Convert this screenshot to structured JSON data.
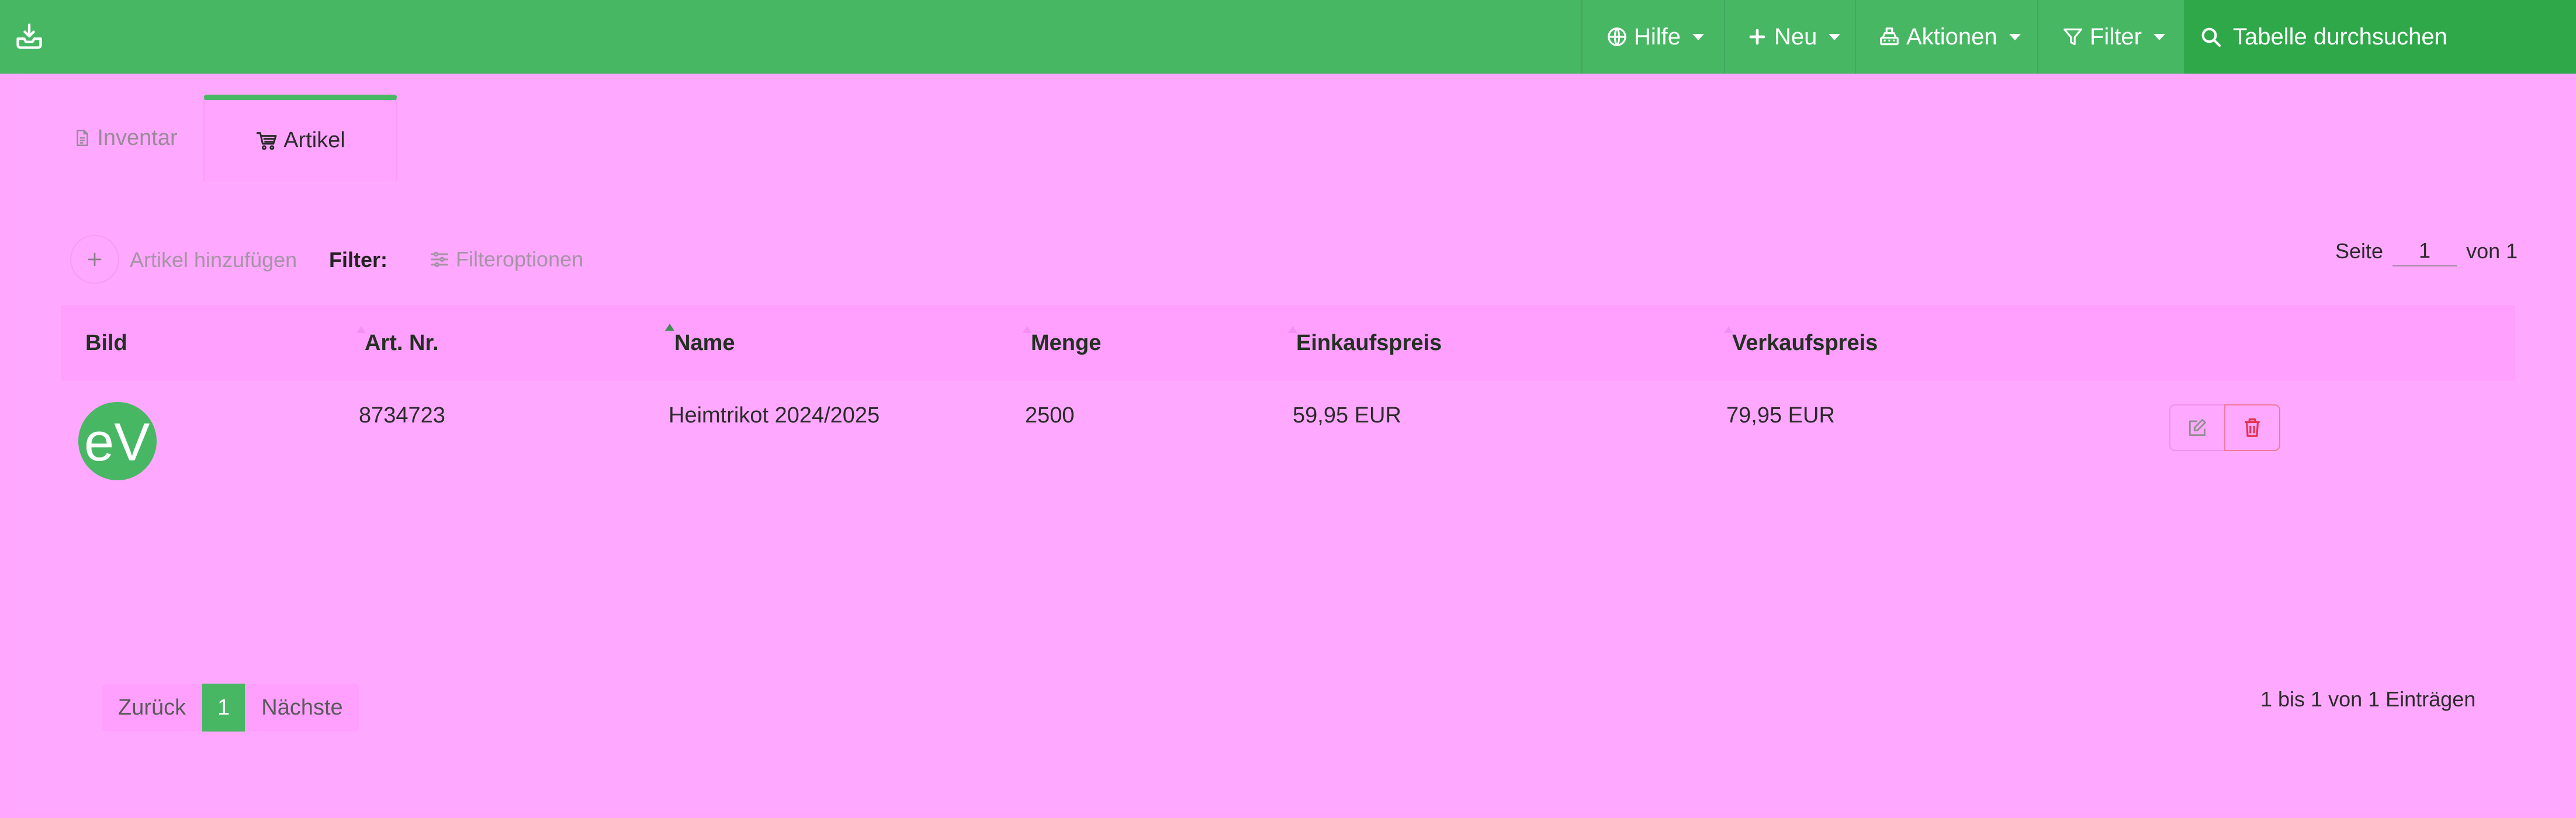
{
  "topbar": {
    "nav": [
      {
        "label": "Hilfe",
        "icon": "globe-icon"
      },
      {
        "label": "Neu",
        "icon": "plus-icon"
      },
      {
        "label": "Aktionen",
        "icon": "cash-register-icon"
      },
      {
        "label": "Filter",
        "icon": "funnel-icon"
      }
    ],
    "search_placeholder": "Tabelle durchsuchen"
  },
  "tabs": [
    {
      "label": "Inventar",
      "icon": "document-icon",
      "active": false
    },
    {
      "label": "Artikel",
      "icon": "cart-icon",
      "active": true
    }
  ],
  "toolbar": {
    "add_label": "Artikel hinzufügen",
    "filter_label": "Filter:",
    "filter_options_label": "Filteroptionen",
    "page_label": "Seite",
    "page_value": "1",
    "page_of": "von 1"
  },
  "table": {
    "columns": [
      "Bild",
      "Art. Nr.",
      "Name",
      "Menge",
      "Einkaufspreis",
      "Verkaufspreis"
    ],
    "sorted_column": "Art. Nr.",
    "rows": [
      {
        "image": "eV",
        "art_nr": "8734723",
        "name": "Heimtrikot 2024/2025",
        "menge": "2500",
        "einkaufspreis": "59,95 EUR",
        "verkaufspreis": "79,95 EUR"
      }
    ]
  },
  "pagination": {
    "prev": "Zurück",
    "current": "1",
    "next": "Nächste",
    "entries": "1 bis 1 von 1 Einträgen"
  },
  "colors": {
    "primary": "#48b764",
    "search_bg": "#2fa84a",
    "background": "#ffa6ff",
    "delete": "#e4334f"
  }
}
